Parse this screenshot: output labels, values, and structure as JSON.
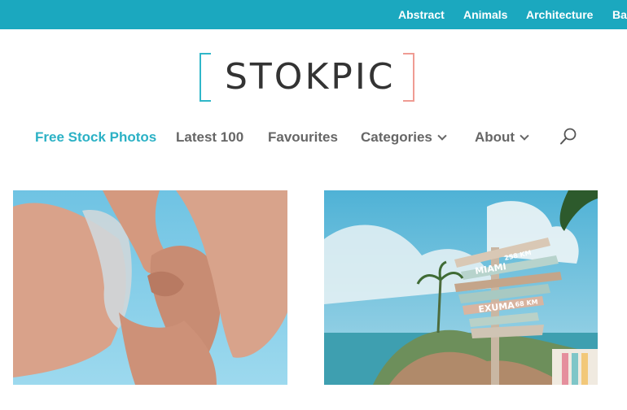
{
  "topbar": {
    "links": [
      "Abstract",
      "Animals",
      "Architecture",
      "Ba"
    ]
  },
  "logo": {
    "text": "STOKPIC"
  },
  "nav": {
    "items": [
      {
        "label": "Free Stock Photos",
        "active": true
      },
      {
        "label": "Latest 100"
      },
      {
        "label": "Favourites"
      },
      {
        "label": "Categories",
        "has_dropdown": true
      },
      {
        "label": "About",
        "has_dropdown": true
      }
    ],
    "search_icon": "search-icon"
  },
  "photos": {
    "left": {
      "subject": "two people seen from below against blue sky"
    },
    "right": {
      "subject": "wooden direction signpost on a tropical beach",
      "signs": [
        "MIAMI",
        "EXUMA"
      ],
      "sign_distances": [
        "258 KM",
        "68 KM"
      ]
    }
  },
  "colors": {
    "brand": "#1ba8bf",
    "active_nav": "#2bb1c5",
    "logo_left_bracket": "#30b7c9",
    "logo_right_bracket": "#ef9c93"
  }
}
